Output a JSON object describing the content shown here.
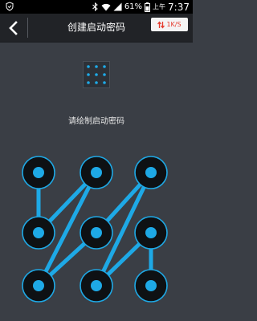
{
  "status_bar": {
    "battery_percent": "61%",
    "ampm": "上午",
    "time": "7:37",
    "icons": [
      "shield-icon",
      "bluetooth-icon",
      "wifi-icon",
      "signal-icon",
      "battery-icon"
    ]
  },
  "header": {
    "back_icon": "chevron-left-icon",
    "title": "创建启动密码",
    "network_speed": "1K/S",
    "speed_icon": "up-down-arrows-icon"
  },
  "preview_icon": "pattern-preview-icon",
  "prompt": "请绘制启动密码",
  "pattern": {
    "grid": "3x3",
    "drawn_sequence": [
      1,
      4,
      2,
      7,
      5,
      3,
      8,
      6,
      9
    ],
    "node_states": [
      "selected",
      "selected",
      "selected",
      "selected",
      "selected",
      "selected",
      "selected",
      "selected",
      "selected"
    ]
  },
  "colors": {
    "background": "#3a3e45",
    "title_bar": "#212327",
    "status_bar": "#000000",
    "accent": "#1ea9e6",
    "node_ring": "#0e1114",
    "speed_text": "#e53a2c"
  }
}
